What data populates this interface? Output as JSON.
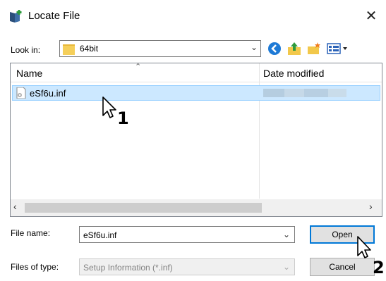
{
  "window": {
    "title": "Locate File",
    "close_label": "✕"
  },
  "lookin": {
    "label": "Look in:",
    "value": "64bit"
  },
  "toolbar": {
    "icons": [
      "back-icon",
      "up-folder-icon",
      "new-folder-icon",
      "view-menu-icon"
    ]
  },
  "file_list": {
    "columns": [
      "Name",
      "Date modified"
    ],
    "rows": [
      {
        "name": "eSf6u.inf"
      }
    ]
  },
  "filename": {
    "label": "File name:",
    "value": "eSf6u.inf"
  },
  "filetype": {
    "label": "Files of type:",
    "value": "Setup Information (*.inf)"
  },
  "buttons": {
    "open": "Open",
    "cancel": "Cancel"
  },
  "annotations": {
    "step1": "1",
    "step2": "2"
  },
  "colors": {
    "selection": "#cce8ff",
    "selection_border": "#99d1ff",
    "focus_border": "#0078d7",
    "folder": "#f2c84b"
  }
}
